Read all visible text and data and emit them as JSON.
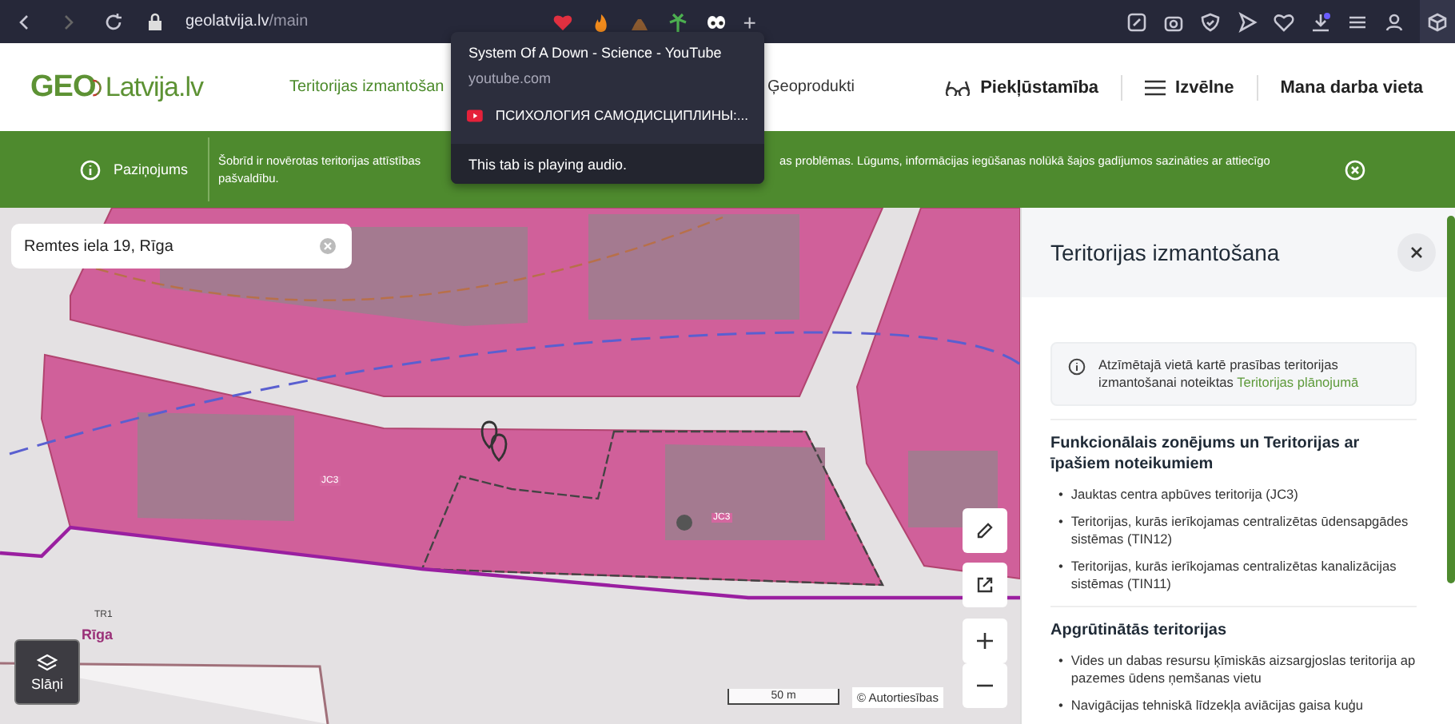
{
  "browser": {
    "url_host": "geolatvija.lv",
    "url_path": "/main",
    "new_tab": "+"
  },
  "tab_popup": {
    "title": "System Of A Down - Science - YouTube",
    "domain": "youtube.com",
    "other_tab": "ПСИХОЛОГИЯ САМОДИСЦИПЛИНЫ:...",
    "status": "This tab is playing audio."
  },
  "header": {
    "logo_geo": "GEO",
    "logo_rest": "Latvija.lv",
    "nav": [
      {
        "label": "Teritorijas izmantošan",
        "selected": true
      },
      {
        "label": "Ģeoprodukti",
        "selected": false
      }
    ],
    "actions": [
      "Piekļūstamība",
      "Izvēlne",
      "Mana darba vieta"
    ]
  },
  "notice": {
    "label": "Paziņojums",
    "text_start": "Šobrīd ir novērotas teritorijas attīstības",
    "text_end": "as problēmas. Lūgums, informācijas iegūšanas nolūkā šajos gadījumos sazināties ar attiecīgo",
    "text_line2": "pašvaldību."
  },
  "map": {
    "search": {
      "value": "Remtes iela 19, Rīga"
    },
    "labels": [
      "JC3",
      "JC3",
      "TR1",
      "Rīga"
    ],
    "layers_button": "Slāņi",
    "scale": "50 m",
    "attribution": "© Autortiesības"
  },
  "panel": {
    "title": "Teritorijas izmantošana",
    "bullet": "•",
    "info_text": "Atzīmētajā vietā kartē prasības teritorijas izmantošanai noteiktas",
    "info_link": "Teritorijas plānojumā",
    "sections": [
      {
        "heading": "Funkcionālais zonējums un Teritorijas ar īpašiem noteikumiem",
        "items": [
          "Jauktas centra apbūves teritorija (JC3)",
          "Teritorijas, kurās ierīkojamas centralizētas ūdensapgādes sistēmas (TIN12)",
          "Teritorijas, kurās ierīkojamas centralizētas kanalizācijas sistēmas (TIN11)"
        ]
      },
      {
        "heading": "Apgrūtinātās teritorijas",
        "items": [
          "Vides un dabas resursu ķīmiskās aizsargjoslas teritorija ap pazemes ūdens ņemšanas vietu",
          "Navigācijas tehniskā līdzekļa aviācijas gaisa kuģu"
        ]
      }
    ]
  }
}
